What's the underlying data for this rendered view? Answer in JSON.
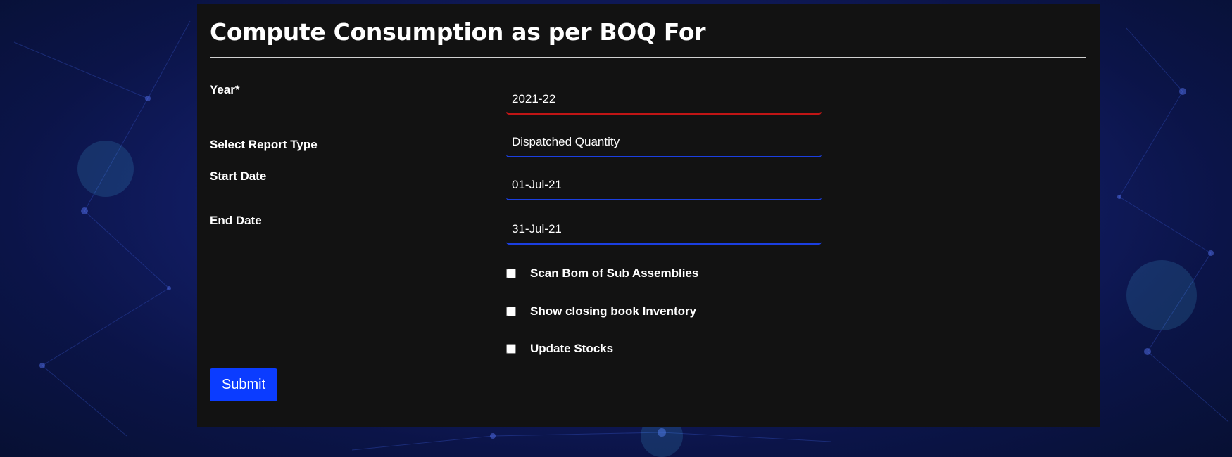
{
  "form": {
    "title": "Compute Consumption as per BOQ For",
    "fields": [
      {
        "label": "Year*",
        "value": "2021-22",
        "state": "invalid"
      },
      {
        "label": "Select Report Type",
        "value": "Dispatched Quantity",
        "state": "normal"
      },
      {
        "label": "Start Date",
        "value": "01-Jul-21",
        "state": "normal"
      },
      {
        "label": "End Date",
        "value": "31-Jul-21",
        "state": "normal"
      }
    ],
    "checkboxes": [
      {
        "label": "Scan Bom of Sub Assemblies",
        "checked": false
      },
      {
        "label": "Show closing book Inventory",
        "checked": false
      },
      {
        "label": "Update Stocks",
        "checked": false
      }
    ],
    "submit_label": "Submit"
  },
  "colors": {
    "panel_bg": "#121212",
    "accent_blue": "#0b3cff",
    "field_underline": "#1b3fe0",
    "invalid_underline": "#c01515",
    "page_bg": "#14206e"
  }
}
